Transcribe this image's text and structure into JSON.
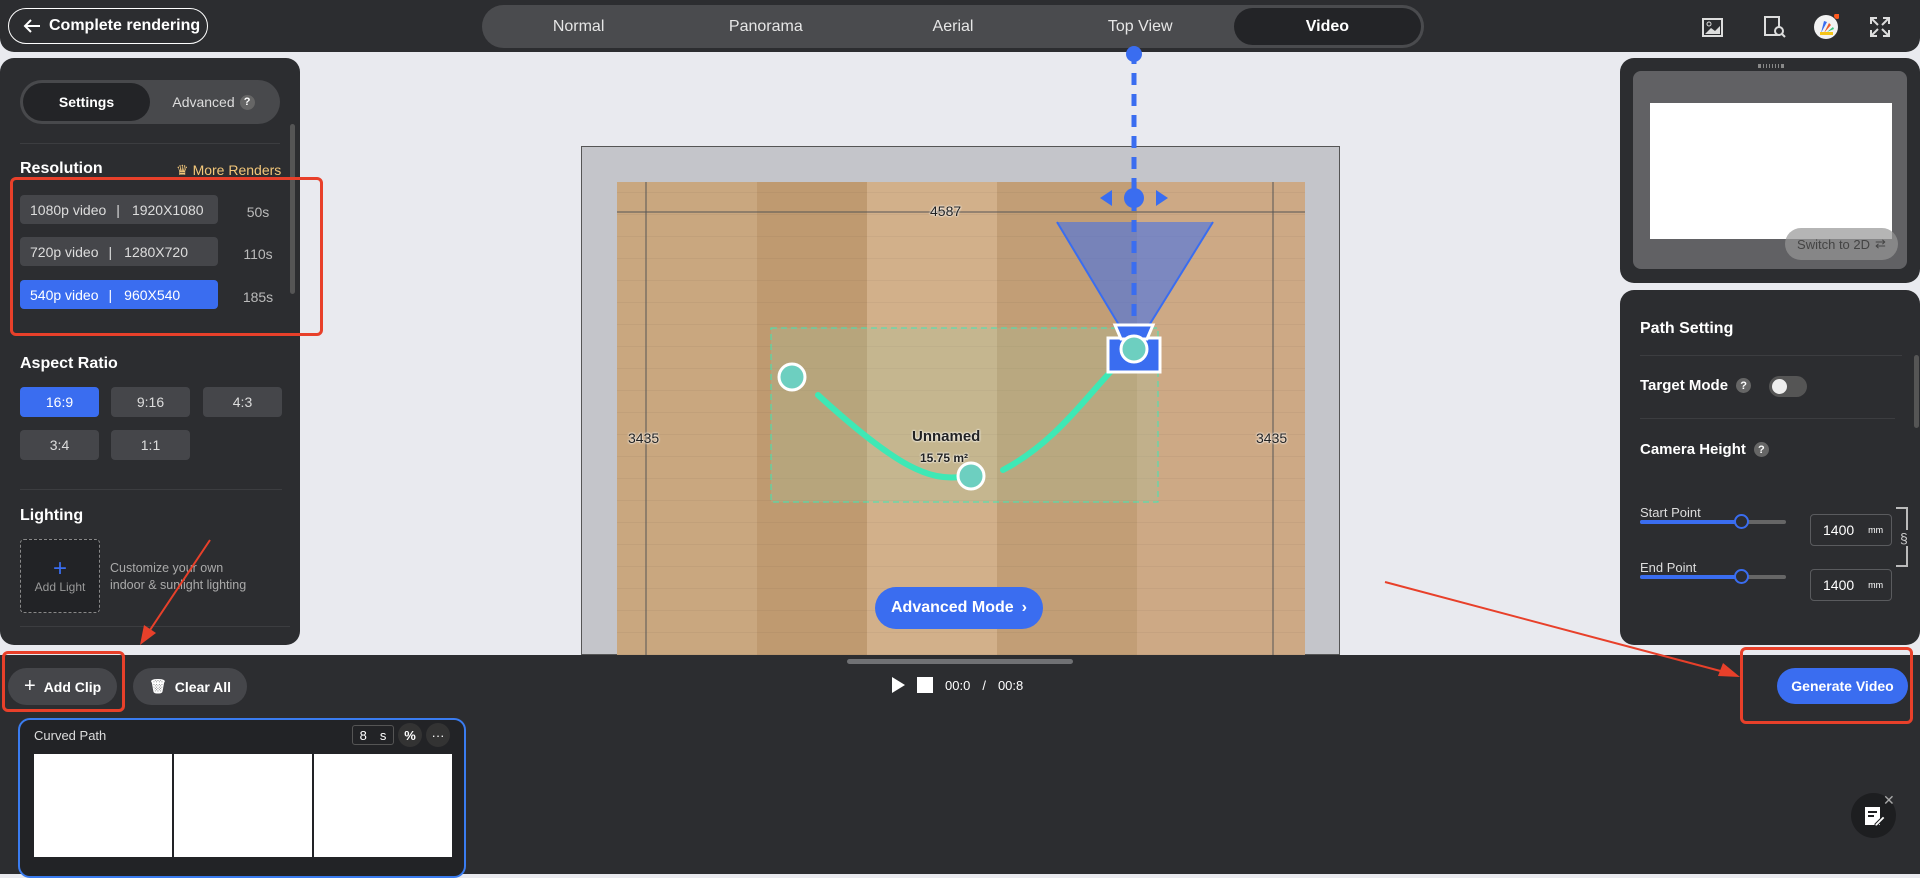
{
  "header": {
    "back_label": "Complete rendering",
    "modes": [
      "Normal",
      "Panorama",
      "Aerial",
      "Top View",
      "Video"
    ],
    "active_mode": "Video",
    "icons": [
      "gallery-icon",
      "preview-search-icon",
      "app-logo-icon",
      "fullscreen-icon"
    ]
  },
  "left_panel": {
    "tabs": [
      "Settings",
      "Advanced"
    ],
    "active_tab": "Settings",
    "resolution": {
      "title": "Resolution",
      "more_label": "More Renders",
      "options": [
        {
          "name": "1080p video",
          "size": "1920X1080",
          "time": "50s"
        },
        {
          "name": "720p video",
          "size": "1280X720",
          "time": "110s"
        },
        {
          "name": "540p video",
          "size": "960X540",
          "time": "185s"
        }
      ],
      "selected": "540p video"
    },
    "aspect": {
      "title": "Aspect Ratio",
      "options": [
        "16:9",
        "9:16",
        "4:3",
        "3:4",
        "1:1"
      ],
      "selected": "16:9"
    },
    "lighting": {
      "title": "Lighting",
      "add_label": "Add Light",
      "desc1": "Customize your own",
      "desc2": "indoor & sunlight lighting"
    }
  },
  "canvas": {
    "width_dim": "4587",
    "height_dim_left": "3435",
    "height_dim_right": "3435",
    "room_name": "Unnamed",
    "room_area": "15.75 m²",
    "advanced_mode_label": "Advanced Mode"
  },
  "preview": {
    "switch_label": "Switch to 2D"
  },
  "path_setting": {
    "title": "Path Setting",
    "target_mode_label": "Target Mode",
    "target_mode_on": false,
    "camera_height_label": "Camera Height",
    "start_label": "Start Point",
    "start_value": "1400",
    "end_label": "End Point",
    "end_value": "1400",
    "unit": "mm",
    "slider_fraction": 0.7
  },
  "timeline": {
    "add_clip_label": "Add Clip",
    "clear_all_label": "Clear All",
    "current_time": "00:0",
    "separator": "/",
    "total_time": "00:8",
    "generate_label": "Generate Video",
    "clip": {
      "title": "Curved Path",
      "duration": "8",
      "duration_unit": "s"
    }
  },
  "colors": {
    "accent": "#3a6df0",
    "panel": "#2c2d30",
    "path": "#3ee8b5",
    "annotation": "#e8402a"
  }
}
